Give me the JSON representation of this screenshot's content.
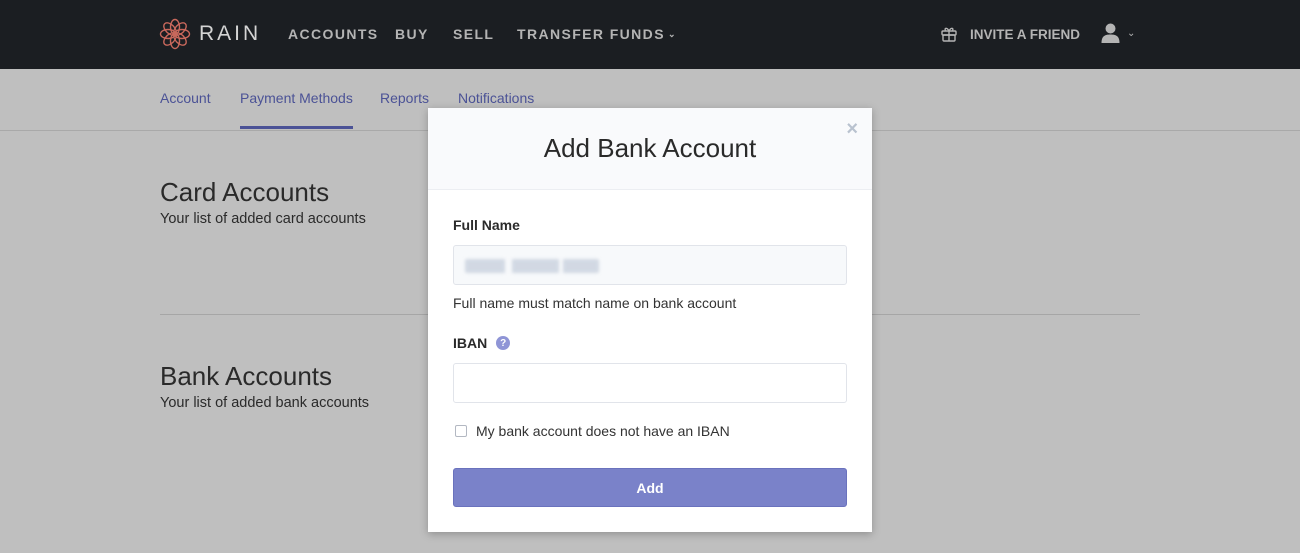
{
  "app": {
    "brand": "RAIN",
    "colors": {
      "topbar": "#1b1e22",
      "logo_accent": "#c8685c",
      "link": "#4b5296",
      "primary_button": "#7a82c9",
      "overlay_background": "#bfbfbf"
    }
  },
  "topnav": {
    "items": [
      {
        "label": "ACCOUNTS"
      },
      {
        "label": "BUY"
      },
      {
        "label": "SELL"
      },
      {
        "label": "TRANSFER FUNDS",
        "has_dropdown": true
      }
    ],
    "invite_label": "INVITE A FRIEND",
    "invite_icon": "gift-icon",
    "user_icon": "user-icon",
    "dropdown_icon": "chevron-down-icon",
    "chevron": "⌄"
  },
  "subnav": {
    "tabs": [
      {
        "label": "Account",
        "active": false
      },
      {
        "label": "Payment Methods",
        "active": true
      },
      {
        "label": "Reports",
        "active": false
      },
      {
        "label": "Notifications",
        "active": false
      }
    ]
  },
  "page": {
    "sections": [
      {
        "title": "Card Accounts",
        "subtitle": "Your list of added card accounts"
      },
      {
        "title": "Bank Accounts",
        "subtitle": "Your list of added bank accounts"
      }
    ]
  },
  "modal": {
    "title": "Add Bank Account",
    "close_glyph": "×",
    "full_name": {
      "label": "Full Name",
      "value": "",
      "value_redacted": true,
      "help_text": "Full name must match name on bank account"
    },
    "iban": {
      "label": "IBAN",
      "help_icon_glyph": "?",
      "value": "",
      "placeholder": ""
    },
    "no_iban_checkbox": {
      "label": "My bank account does not have an IBAN",
      "checked": false
    },
    "submit_label": "Add"
  }
}
